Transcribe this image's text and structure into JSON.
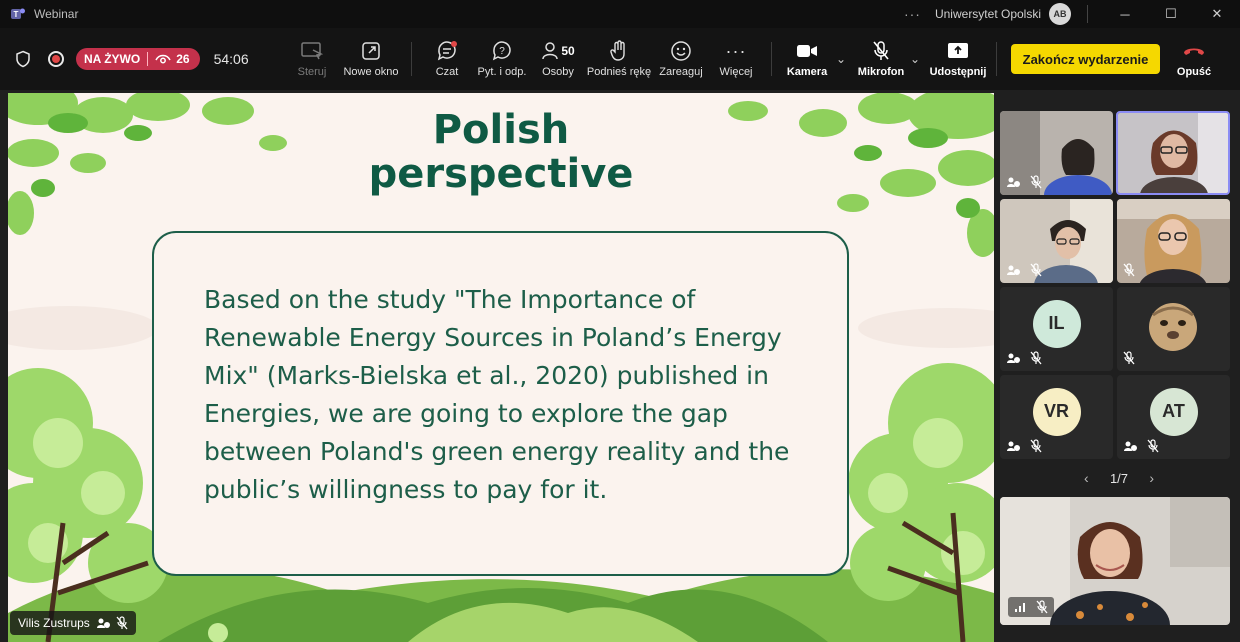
{
  "window": {
    "title": "Webinar",
    "org": "Uniwersytet Opolski",
    "avatar_initials": "AB"
  },
  "toolbar": {
    "live_label": "NA ŻYWO",
    "viewers": "26",
    "timer": "54:06",
    "items": {
      "steruj": "Steruj",
      "nowe_okno": "Nowe okno",
      "czat": "Czat",
      "qa": "Pyt. i odp.",
      "osoby": "Osoby",
      "osoby_count": "50",
      "podnies": "Podnieś rękę",
      "zareaguj": "Zareaguj",
      "wiecej": "Więcej",
      "kamera": "Kamera",
      "mikrofon": "Mikrofon",
      "udostepnij": "Udostępnij",
      "opusc": "Opuść"
    },
    "end_label": "Zakończ wydarzenie"
  },
  "slide": {
    "title_line1": "Polish",
    "title_line2": "perspective",
    "body": "Based on the study \"The Importance of Renewable Energy Sources in Poland’s Energy Mix\" (Marks-Bielska et al., 2020) published in Energies, we are going to explore the gap between Poland's green energy reality and the public’s willingness to pay for it."
  },
  "presenter": {
    "name": "Vilis Zustrups"
  },
  "gallery": {
    "tiles": [
      {
        "initials": "IL",
        "color": "#cfe9da"
      },
      {
        "initials": "VR",
        "color": "#f7eec4"
      },
      {
        "initials": "AT",
        "color": "#d7e6d4"
      }
    ],
    "pager": "1/7"
  },
  "colors": {
    "accent": "#8b8cf4",
    "live": "#c4314b",
    "end": "#f5d800",
    "slide_green": "#1d5e49"
  }
}
